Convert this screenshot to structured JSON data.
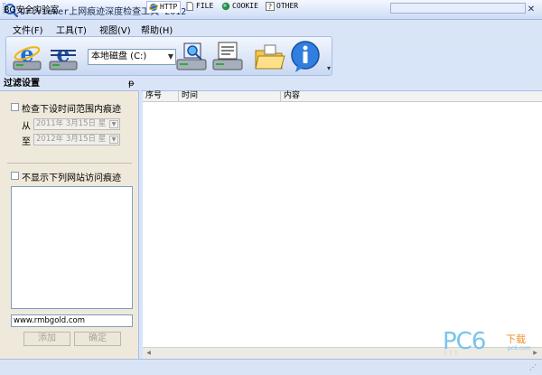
{
  "window": {
    "title": "UrlViewer上网痕迹深度检查工具 2012",
    "minimize": "—",
    "maximize": "□",
    "close": "✕"
  },
  "menu": {
    "items": [
      "文件(F)",
      "工具(T)",
      "视图(V)",
      "帮助(H)"
    ]
  },
  "toolbar": {
    "drive_select": "本地磁盘 (C:)",
    "overflow": "▾",
    "icons": [
      "ie-browser-icon",
      "network-browser-icon",
      "disk-scan-icon",
      "disk-report-icon",
      "folder-open-icon",
      "info-icon"
    ]
  },
  "left_panel": {
    "header": "过滤设置",
    "pin": "ᵽ",
    "time_filter_label": "检查下设时间范围内痕迹",
    "from_label": "从",
    "to_label": "至",
    "date_from": "2011年 3月15日 星",
    "date_to": "2012年 3月15日 星",
    "site_filter_label": "不显示下列网站访问痕迹",
    "url_value": "www.rmbgold.com",
    "add_button": "添加",
    "confirm_button": "确定"
  },
  "tabs": [
    {
      "label": "HTTP",
      "icon": "ie-icon"
    },
    {
      "label": "FILE",
      "icon": "file-icon"
    },
    {
      "label": "COOKIE",
      "icon": "cookie-icon"
    },
    {
      "label": "OTHER",
      "icon": "question-icon"
    }
  ],
  "table": {
    "columns": [
      "序号",
      "时间",
      "内容"
    ]
  },
  "status": {
    "text": "BG安全实验室"
  },
  "watermark": {
    "brand": "PC6",
    "sub": "下载",
    "url": "pc6.com"
  },
  "colors": {
    "accent_blue": "#2a62c9",
    "frame_blue": "#d9e4f7",
    "panel_beige": "#efe9dc",
    "watermark_blue": "#79c4ea",
    "watermark_orange": "#f08e2a"
  }
}
